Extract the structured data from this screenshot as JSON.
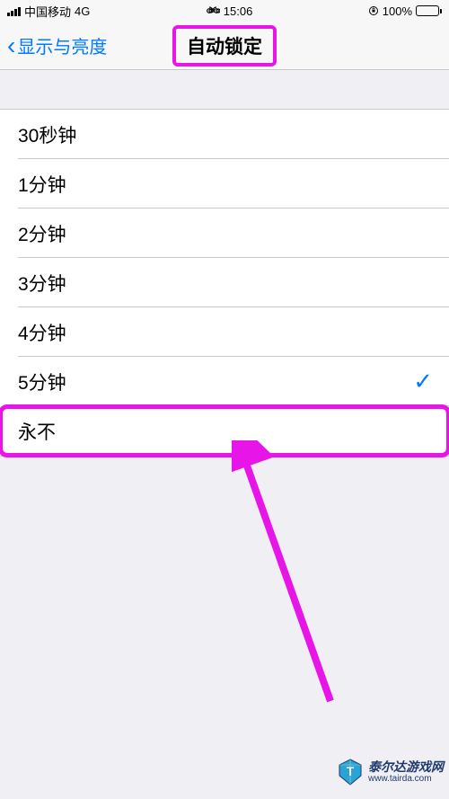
{
  "status_bar": {
    "carrier": "中国移动",
    "network": "4G",
    "time": "15:06",
    "battery_percent": "100%"
  },
  "nav": {
    "back_label": "显示与亮度",
    "title": "自动锁定"
  },
  "options": [
    {
      "label": "30秒钟",
      "selected": false
    },
    {
      "label": "1分钟",
      "selected": false
    },
    {
      "label": "2分钟",
      "selected": false
    },
    {
      "label": "3分钟",
      "selected": false
    },
    {
      "label": "4分钟",
      "selected": false
    },
    {
      "label": "5分钟",
      "selected": true
    },
    {
      "label": "永不",
      "selected": false
    }
  ],
  "watermark": {
    "title": "泰尔达游戏网",
    "url": "www.tairda.com"
  },
  "annotation": {
    "title_highlight": true,
    "row_highlight_index": 6,
    "arrow_color": "#e815e8"
  }
}
